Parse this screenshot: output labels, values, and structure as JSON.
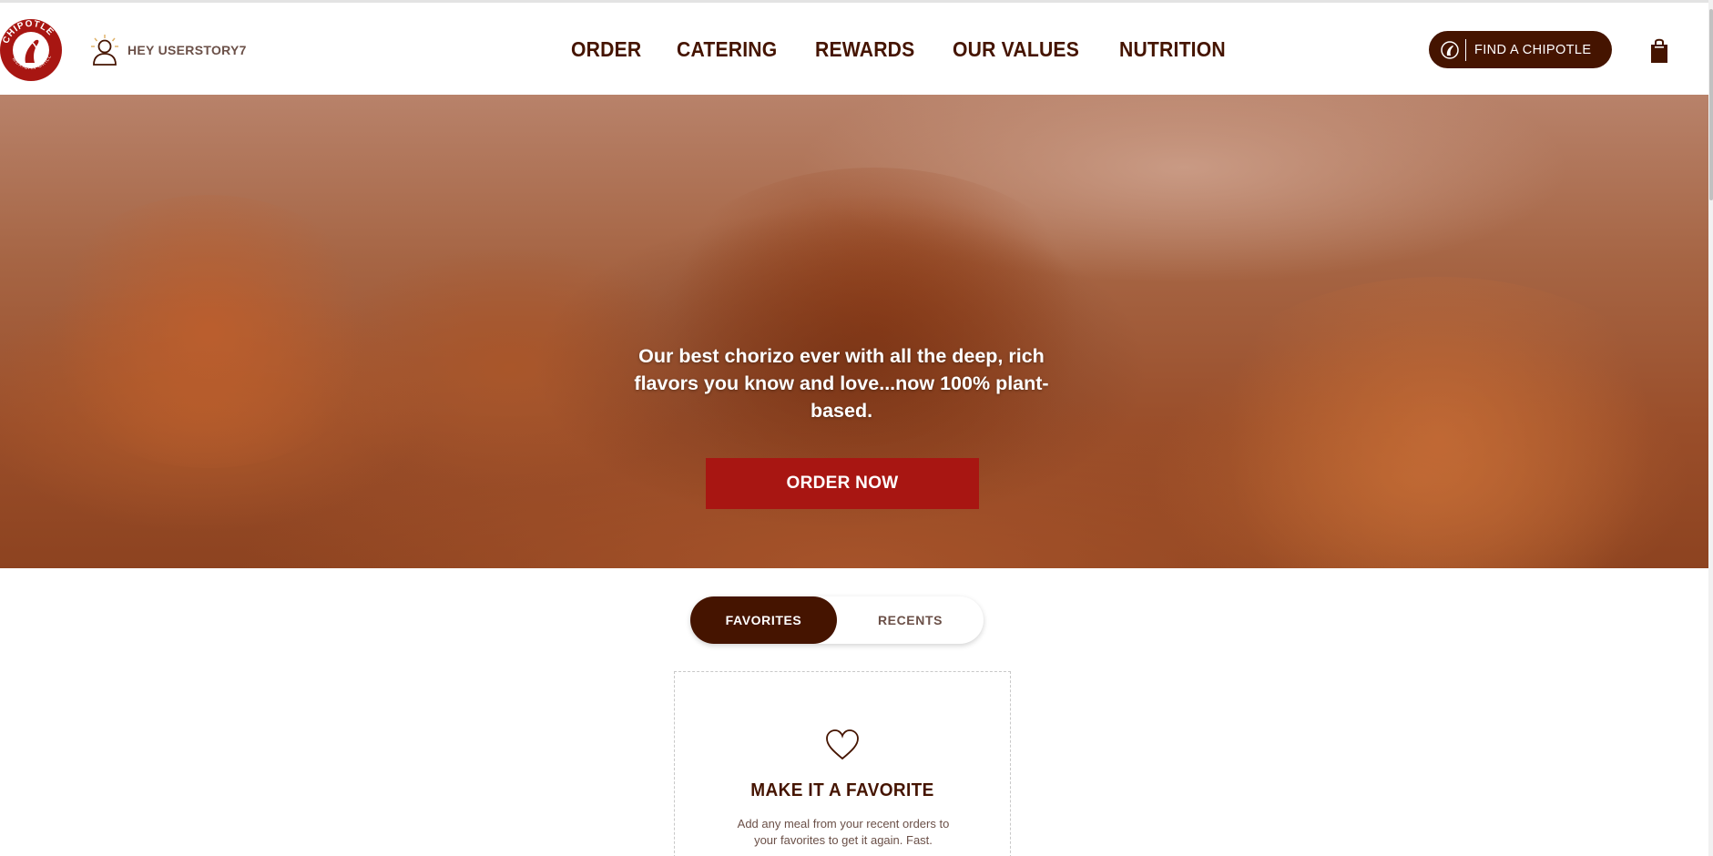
{
  "header": {
    "logo_alt": "CHIPOTLE MEXICAN GRILL",
    "greeting": "HEY USERSTORY7",
    "nav": [
      "ORDER",
      "CATERING",
      "REWARDS",
      "OUR VALUES",
      "NUTRITION"
    ],
    "find_button": "FIND A CHIPOTLE",
    "bag_icon": "shopping-bag-icon"
  },
  "hero": {
    "text": "Our best chorizo ever with all the deep, rich flavors you know and love...now 100% plant-based.",
    "cta": "ORDER NOW"
  },
  "tabs": {
    "active": "FAVORITES",
    "inactive": "RECENTS"
  },
  "favorites_card": {
    "title": "MAKE IT A FAVORITE",
    "description": "Add any meal from your recent orders to your favorites to get it again. Fast."
  },
  "colors": {
    "brand_brown": "#451400",
    "brand_red": "#a81612"
  }
}
